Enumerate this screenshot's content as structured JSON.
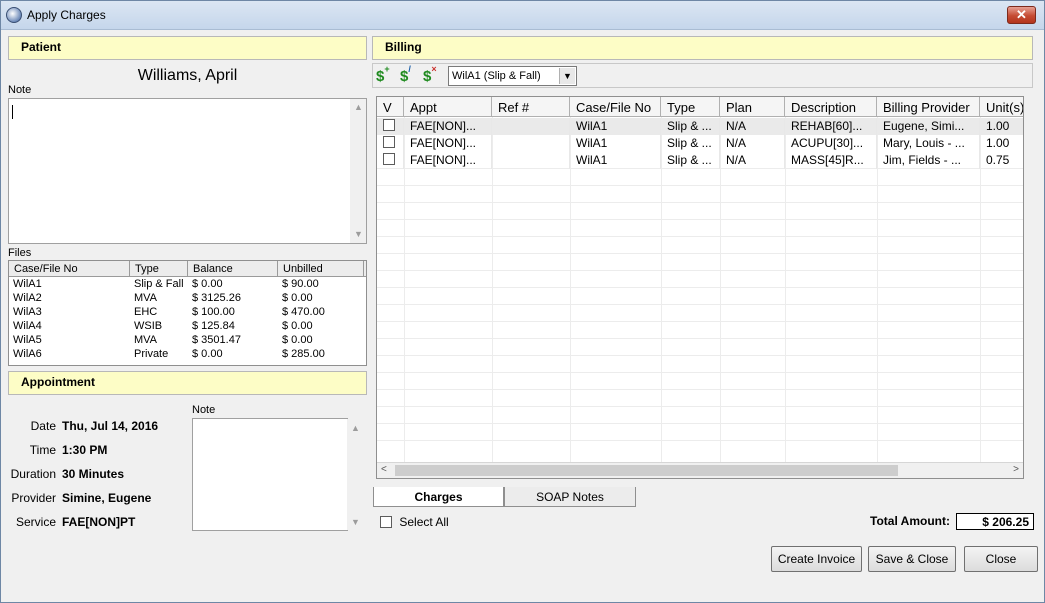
{
  "window": {
    "title": "Apply Charges",
    "close_label": "✕"
  },
  "patient": {
    "header": "Patient",
    "name": "Williams, April",
    "note_label": "Note",
    "note_value": "",
    "files_label": "Files",
    "files_columns": [
      "Case/File No",
      "Type",
      "Balance",
      "Unbilled"
    ],
    "files": [
      [
        "WilA1",
        "Slip & Fall",
        "$ 0.00",
        "$ 90.00"
      ],
      [
        "WilA2",
        "MVA",
        "$ 3125.26",
        "$ 0.00"
      ],
      [
        "WilA3",
        "EHC",
        "$ 100.00",
        "$ 470.00"
      ],
      [
        "WilA4",
        "WSIB",
        "$ 125.84",
        "$ 0.00"
      ],
      [
        "WilA5",
        "MVA",
        "$ 3501.47",
        "$ 0.00"
      ],
      [
        "WilA6",
        "Private",
        "$ 0.00",
        "$ 285.00"
      ]
    ]
  },
  "appointment": {
    "header": "Appointment",
    "note_label": "Note",
    "fields": [
      {
        "label": "Date",
        "value": "Thu, Jul 14, 2016"
      },
      {
        "label": "Time",
        "value": "1:30 PM"
      },
      {
        "label": "Duration",
        "value": "30 Minutes"
      },
      {
        "label": "Provider",
        "value": "Simine, Eugene"
      },
      {
        "label": "Service",
        "value": "FAE[NON]PT"
      }
    ]
  },
  "billing": {
    "header": "Billing",
    "toolbar": {
      "icons": [
        "add-charge-icon",
        "edit-charge-icon",
        "delete-charge-icon"
      ],
      "case_select": "WilA1 (Slip & Fall)"
    },
    "columns": [
      "V",
      "Appt",
      "Ref #",
      "Case/File No",
      "Type",
      "Plan",
      "Description",
      "Billing Provider",
      "Unit(s)"
    ],
    "rows": [
      [
        "",
        "FAE[NON]...",
        "",
        "WilA1",
        "Slip & ...",
        "N/A",
        "REHAB[60]...",
        "Eugene, Simi...",
        "1.00"
      ],
      [
        "",
        "FAE[NON]...",
        "",
        "WilA1",
        "Slip & ...",
        "N/A",
        "ACUPU[30]...",
        "Mary, Louis - ...",
        "1.00"
      ],
      [
        "",
        "FAE[NON]...",
        "",
        "WilA1",
        "Slip & ...",
        "N/A",
        "MASS[45]R...",
        "Jim, Fields - ...",
        "0.75"
      ]
    ],
    "tabs": [
      "Charges",
      "SOAP Notes"
    ],
    "select_all_label": "Select All",
    "total_label": "Total Amount:",
    "total_value": "$ 206.25"
  },
  "buttons": {
    "create_invoice": "Create Invoice",
    "save_close": "Save & Close",
    "close": "Close"
  },
  "colors": {
    "section_header_bg": "#fdfdc6",
    "titlebar_bg": "#c5d6eb",
    "icon_green": "#1f8a1f"
  }
}
